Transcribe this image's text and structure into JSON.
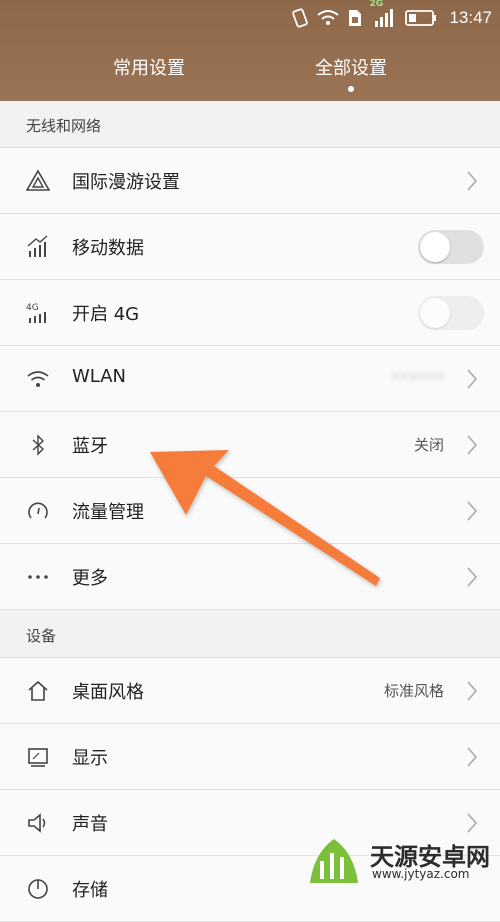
{
  "status_bar": {
    "network_badge": "2G",
    "time": "13:47"
  },
  "tabs": [
    {
      "label": "常用设置"
    },
    {
      "label": "全部设置"
    }
  ],
  "sections": {
    "wireless": "无线和网络",
    "device": "设备"
  },
  "rows": [
    {
      "label": "国际漫游设置",
      "icon": "roaming-triangle-icon"
    },
    {
      "label": "移动数据",
      "icon": "mobile-data-icon",
      "toggle": false
    },
    {
      "label": "开启 4G",
      "icon": "4g-signal-icon",
      "toggle": false
    },
    {
      "label": "WLAN",
      "icon": "wifi-icon",
      "value": "••••••"
    },
    {
      "label": "蓝牙",
      "icon": "bluetooth-icon",
      "value": "关闭"
    },
    {
      "label": "流量管理",
      "icon": "data-usage-icon"
    },
    {
      "label": "更多",
      "icon": "more-dots-icon"
    },
    {
      "label": "桌面风格",
      "icon": "home-icon",
      "value": "标准风格"
    },
    {
      "label": "显示",
      "icon": "display-icon"
    },
    {
      "label": "声音",
      "icon": "speaker-icon"
    },
    {
      "label": "存储",
      "icon": "storage-icon"
    }
  ],
  "watermark": {
    "text": "天源安卓网",
    "url": "www.jytyaz.com"
  },
  "colors": {
    "header": "#96704f",
    "arrow": "#f57c3a"
  }
}
